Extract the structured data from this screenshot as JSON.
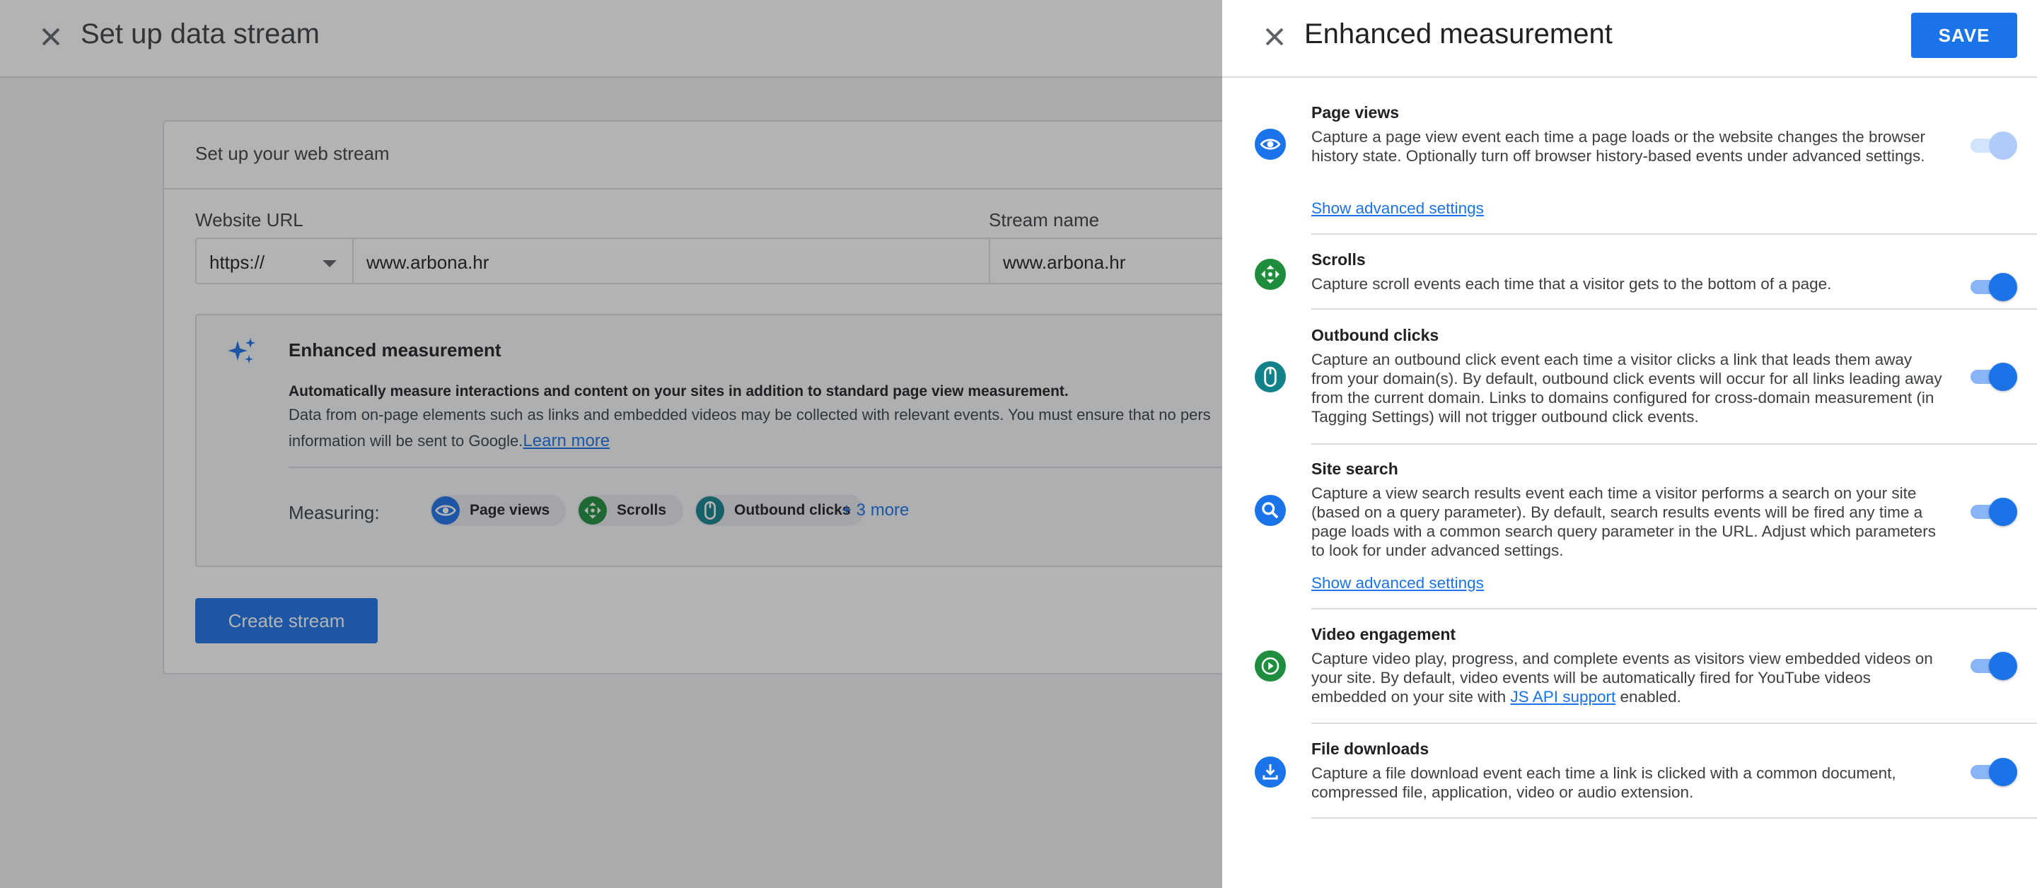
{
  "background": {
    "page_title": "Set up data stream",
    "card_title": "Set up your web stream",
    "website_url_label": "Website URL",
    "protocol_value": "https://",
    "url_value": "www.arbona.hr",
    "stream_name_label": "Stream name",
    "stream_name_value": "www.arbona.hr",
    "enhanced": {
      "title": "Enhanced measurement",
      "bold_text": "Automatically measure interactions and content on your sites in addition to standard page view measurement.",
      "desc_line1": "Data from on-page elements such as links and embedded videos may be collected with relevant events. You must ensure that no pers",
      "desc_line2": "information will be sent to Google.",
      "learn_more": "Learn more",
      "measuring_label": "Measuring:",
      "chips": [
        "Page views",
        "Scrolls",
        "Outbound clicks"
      ],
      "more": "+ 3 more"
    },
    "create_button": "Create stream"
  },
  "panel": {
    "title": "Enhanced measurement",
    "save_label": "SAVE",
    "items": [
      {
        "title": "Page views",
        "icon": "eye-icon",
        "description": "Capture a page view event each time a page loads or the website changes the browser history state. Optionally turn off browser history-based events under advanced settings.",
        "advanced": "Show advanced settings",
        "enabled": true,
        "disabled": true
      },
      {
        "title": "Scrolls",
        "icon": "scroll-arrows-icon",
        "description": "Capture scroll events each time that a visitor gets to the bottom of a page.",
        "enabled": true
      },
      {
        "title": "Outbound clicks",
        "icon": "mouse-icon",
        "description": "Capture an outbound click event each time a visitor clicks a link that leads them away from your domain(s). By default, outbound click events will occur for all links leading away from the current domain. Links to domains configured for cross-domain measurement (in Tagging Settings) will not trigger outbound click events.",
        "enabled": true
      },
      {
        "title": "Site search",
        "icon": "search-icon",
        "description": "Capture a view search results event each time a visitor performs a search on your site (based on a query parameter). By default, search results events will be fired any time a page loads with a common search query parameter in the URL. Adjust which parameters to look for under advanced settings.",
        "advanced": "Show advanced settings",
        "enabled": true
      },
      {
        "title": "Video engagement",
        "icon": "play-icon",
        "description_before": "Capture video play, progress, and complete events as visitors view embedded videos on your site. By default, video events will be automatically fired for YouTube videos embedded on your site with ",
        "link": "JS API support",
        "description_after": " enabled.",
        "enabled": true
      },
      {
        "title": "File downloads",
        "icon": "download-icon",
        "description": "Capture a file download event each time a link is clicked with a common document, compressed file, application, video or audio extension.",
        "enabled": true
      }
    ]
  },
  "colors": {
    "accent": "#1a73e8",
    "blue_icon": "#1a73e8",
    "green_icon": "#1e8e3e",
    "teal_icon": "#12828a"
  }
}
